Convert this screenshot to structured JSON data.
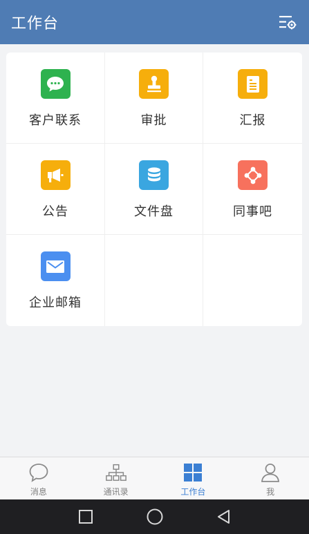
{
  "header": {
    "title": "工作台",
    "settings_icon": "filter-settings-icon"
  },
  "apps": [
    {
      "label": "客户联系",
      "icon": "chat-bubble-icon",
      "color": "#2eb24f"
    },
    {
      "label": "审批",
      "icon": "stamp-icon",
      "color": "#f6ae0c"
    },
    {
      "label": "汇报",
      "icon": "document-icon",
      "color": "#f6ae0c"
    },
    {
      "label": "公告",
      "icon": "megaphone-icon",
      "color": "#f6ae0c"
    },
    {
      "label": "文件盘",
      "icon": "database-icon",
      "color": "#3aa6e0"
    },
    {
      "label": "同事吧",
      "icon": "share-nodes-icon",
      "color": "#f7715d"
    },
    {
      "label": "企业邮箱",
      "icon": "envelope-icon",
      "color": "#4b8ff0"
    }
  ],
  "tabbar": {
    "tabs": [
      {
        "label": "消息",
        "icon": "message-bubble-icon",
        "active": false
      },
      {
        "label": "通讯录",
        "icon": "org-chart-icon",
        "active": false
      },
      {
        "label": "工作台",
        "icon": "grid-icon",
        "active": true
      },
      {
        "label": "我",
        "icon": "person-icon",
        "active": false
      }
    ],
    "active_color": "#3b7fd3",
    "inactive_color": "#808080"
  },
  "system_nav": {
    "buttons": [
      "recent-apps-icon",
      "home-icon",
      "back-icon"
    ]
  },
  "colors": {
    "header_bg": "#4f7cb4",
    "page_bg": "#f2f3f5",
    "navbar_bg": "#1f1f22"
  }
}
